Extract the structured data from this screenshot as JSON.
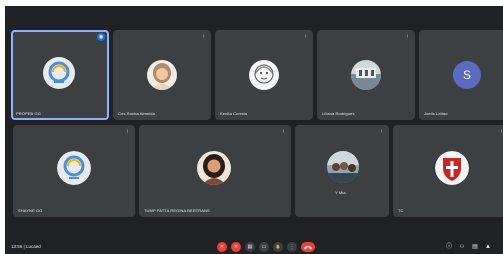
{
  "participants": [
    {
      "name": "PROPEB GG",
      "type": "logo",
      "muted": false,
      "speaking": true
    },
    {
      "name": "Cris Rocha Almeida",
      "type": "photo-woman-light",
      "muted": true
    },
    {
      "name": "Kenita Correia",
      "type": "photo-woman-sketch",
      "muted": true
    },
    {
      "name": "Liliana Rodrigues",
      "type": "photo-building",
      "muted": true
    },
    {
      "name": "Joelis Leitao",
      "type": "initial",
      "initial": "S",
      "muted": false
    },
    {
      "name": "SHAYNE GG",
      "type": "logo",
      "muted": true
    },
    {
      "name": "TUMP PATTA REGINA BERTRANS",
      "type": "photo-woman-dark",
      "muted": true
    },
    {
      "name": "Y Mia",
      "type": "photo-group",
      "muted": true
    },
    {
      "name": "TC",
      "type": "crest",
      "muted": true
    }
  ],
  "bottom_bar": {
    "time": "13:56",
    "separator": "|",
    "meeting_code": "Lucaed"
  },
  "icons": {
    "mic_off": "✕",
    "present": "▭",
    "hand": "✋",
    "more": "⋮",
    "info": "ⓘ",
    "people": "👥",
    "chat": "▤",
    "activities": "▲"
  },
  "colors": {
    "background": "#202124",
    "tile": "#3c4043",
    "accent": "#1a73e8",
    "danger": "#ea4335"
  }
}
